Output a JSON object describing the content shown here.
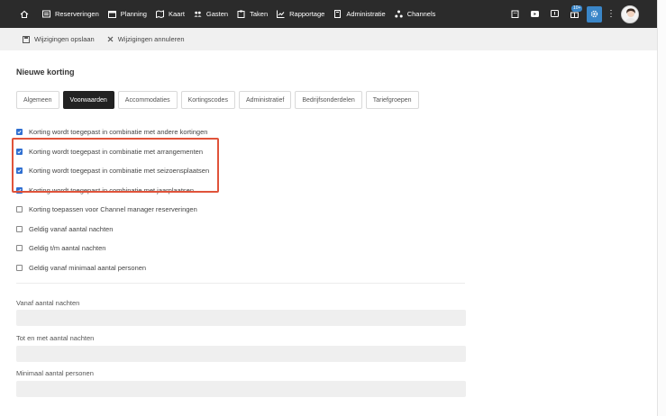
{
  "nav": {
    "items": [
      {
        "label": "Reserveringen",
        "icon": "calendar-list-icon"
      },
      {
        "label": "Planning",
        "icon": "calendar-icon"
      },
      {
        "label": "Kaart",
        "icon": "map-icon"
      },
      {
        "label": "Gasten",
        "icon": "users-icon"
      },
      {
        "label": "Taken",
        "icon": "clipboard-icon"
      },
      {
        "label": "Rapportage",
        "icon": "chart-icon"
      },
      {
        "label": "Administratie",
        "icon": "document-icon"
      },
      {
        "label": "Channels",
        "icon": "network-icon"
      }
    ],
    "badge": "10+"
  },
  "actions": {
    "save": "Wijzigingen opslaan",
    "cancel": "Wijzigingen annuleren"
  },
  "page": {
    "title": "Nieuwe korting"
  },
  "tabs": [
    "Algemeen",
    "Voorwaarden",
    "Accommodaties",
    "Kortingscodes",
    "Administratief",
    "Bedrijfsonderdelen",
    "Tariefgroepen"
  ],
  "active_tab": "Voorwaarden",
  "checkboxes": [
    {
      "label": "Korting wordt toegepast in combinatie met andere kortingen",
      "checked": true
    },
    {
      "label": "Korting wordt toegepast in combinatie met arrangementen",
      "checked": true
    },
    {
      "label": "Korting wordt toegepast in combinatie met seizoensplaatsen",
      "checked": true
    },
    {
      "label": "Korting wordt toegepast in combinatie met jaarplaatsen",
      "checked": true
    },
    {
      "label": "Korting toepassen voor Channel manager reserveringen",
      "checked": false
    },
    {
      "label": "Geldig vanaf aantal nachten",
      "checked": false
    },
    {
      "label": "Geldig t/m aantal nachten",
      "checked": false
    },
    {
      "label": "Geldig vanaf minimaal aantal personen",
      "checked": false
    }
  ],
  "fields": {
    "vanaf_label": "Vanaf aantal nachten",
    "tot_label": "Tot en met aantal nachten",
    "min_label": "Minimaal aantal personen"
  },
  "colors": {
    "nav_bg": "#2b2b2b",
    "accent": "#3a86c8",
    "checkbox": "#2f6fd1",
    "highlight": "#e0533a"
  }
}
